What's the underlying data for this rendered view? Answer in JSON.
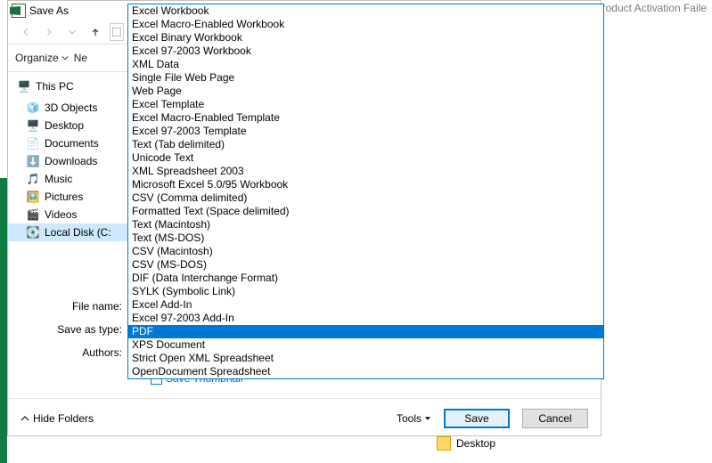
{
  "outside": {
    "activation_text": "Product Activation Faile",
    "footer_desktop": "Desktop"
  },
  "dialog": {
    "title": "Save As",
    "organize": "Organize",
    "new_cut": "Ne",
    "nav": [
      {
        "label": "This PC",
        "icon": "pc"
      },
      {
        "label": "3D Objects",
        "icon": "3d"
      },
      {
        "label": "Desktop",
        "icon": "desktop"
      },
      {
        "label": "Documents",
        "icon": "docs"
      },
      {
        "label": "Downloads",
        "icon": "down"
      },
      {
        "label": "Music",
        "icon": "music"
      },
      {
        "label": "Pictures",
        "icon": "pics"
      },
      {
        "label": "Videos",
        "icon": "vids"
      },
      {
        "label": "Local Disk (C:",
        "icon": "disk"
      }
    ],
    "field_filename": "File name:",
    "field_savetype": "Save as type:",
    "field_authors": "Authors:",
    "save_thumbnail": "Save Thumbnail",
    "hide_folders": "Hide Folders",
    "tools": "Tools",
    "save": "Save",
    "cancel": "Cancel"
  },
  "dropdown": {
    "selected_index": 25,
    "options": [
      "Excel Workbook",
      "Excel Macro-Enabled Workbook",
      "Excel Binary Workbook",
      "Excel 97-2003 Workbook",
      "XML Data",
      "Single File Web Page",
      "Web Page",
      "Excel Template",
      "Excel Macro-Enabled Template",
      "Excel 97-2003 Template",
      "Text (Tab delimited)",
      "Unicode Text",
      "XML Spreadsheet 2003",
      "Microsoft Excel 5.0/95 Workbook",
      "CSV (Comma delimited)",
      "Formatted Text (Space delimited)",
      "Text (Macintosh)",
      "Text (MS-DOS)",
      "CSV (Macintosh)",
      "CSV (MS-DOS)",
      "DIF (Data Interchange Format)",
      "SYLK (Symbolic Link)",
      "Excel Add-In",
      "Excel 97-2003 Add-In",
      "PDF",
      "XPS Document",
      "Strict Open XML Spreadsheet",
      "OpenDocument Spreadsheet"
    ]
  }
}
